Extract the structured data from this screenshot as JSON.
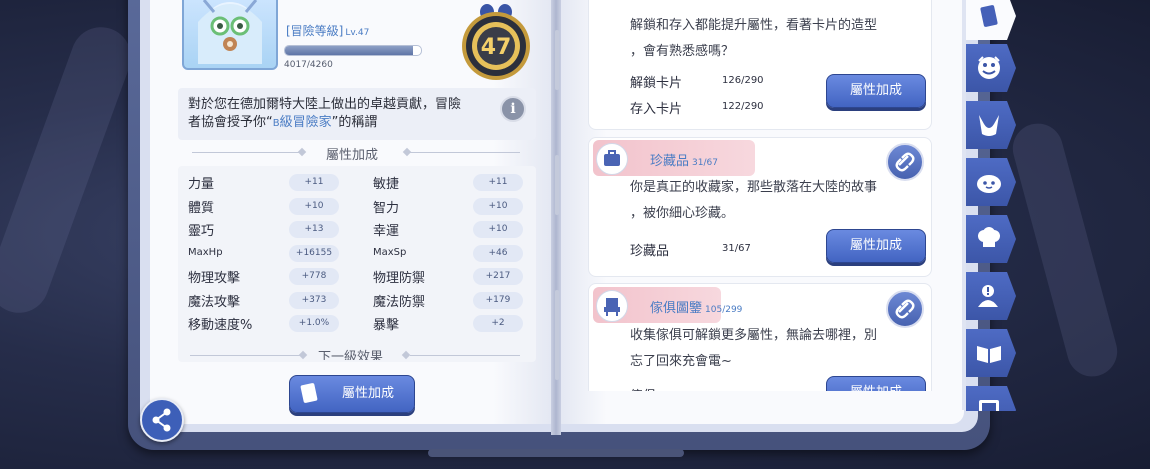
{
  "left_page": {
    "rank_label": "[冒險等級]",
    "rank_level": "Lv.47",
    "exp_text": "4017/4260",
    "exp_fraction": 0.943,
    "medal_number": "47",
    "description": {
      "line1": "對於您在德加爾特大陸上做出的卓越貢獻，冒險",
      "line2_prefix": "者協會授予你“",
      "line2_rank_small": "B",
      "line2_rank": "級冒險家",
      "line2_suffix": "”的稱謂"
    },
    "info_icon_label": "i",
    "attr_section_title": "屬性加成",
    "stats": [
      {
        "name": "力量",
        "value": "+11"
      },
      {
        "name": "敏捷",
        "value": "+11"
      },
      {
        "name": "體質",
        "value": "+10"
      },
      {
        "name": "智力",
        "value": "+10"
      },
      {
        "name": "靈巧",
        "value": "+13"
      },
      {
        "name": "幸運",
        "value": "+10"
      },
      {
        "name": "MaxHp",
        "value": "+16155"
      },
      {
        "name": "MaxSp",
        "value": "+46"
      },
      {
        "name": "物理攻擊",
        "value": "+778"
      },
      {
        "name": "物理防禦",
        "value": "+217"
      },
      {
        "name": "魔法攻擊",
        "value": "+373"
      },
      {
        "name": "魔法防禦",
        "value": "+179"
      },
      {
        "name": "移動速度%",
        "value": "+1.0%"
      },
      {
        "name": "暴擊",
        "value": "+2"
      }
    ],
    "next_level_title": "下一級效果",
    "attr_button_label": "屬性加成"
  },
  "right_page": {
    "card1": {
      "text_line1": "解鎖和存入都能提升屬性，看著卡片的造型",
      "text_line2": "，會有熟悉感嗎？",
      "rows": [
        {
          "label": "解鎖卡片",
          "value": "126/290"
        },
        {
          "label": "存入卡片",
          "value": "122/290"
        }
      ],
      "button_label": "屬性加成"
    },
    "card2": {
      "title": "珍藏品",
      "count": "31/67",
      "text_line1": "你是真正的收藏家，那些散落在大陸的故事",
      "text_line2": "，被你細心珍藏。",
      "row_label": "珍藏品",
      "row_value": "31/67",
      "button_label": "屬性加成"
    },
    "card3": {
      "title": "傢俱圖鑒",
      "count": "105/299",
      "text_line1": "收集傢俱可解鎖更多屬性，無論去哪裡，別",
      "text_line2": "忘了回來充會電~",
      "row_label": "傢俱",
      "button_label": "屬性加成"
    }
  },
  "tabs": [
    "card-tab",
    "monster-tab",
    "pet-tab",
    "npc-tab",
    "cooking-tab",
    "achievement-tab",
    "book-tab",
    "photo-tab"
  ],
  "colors": {
    "accent": "#4a7cc4",
    "button": "#4a6ad0",
    "tab": "#4560b8",
    "tag_pink": "#f2c3cc"
  }
}
